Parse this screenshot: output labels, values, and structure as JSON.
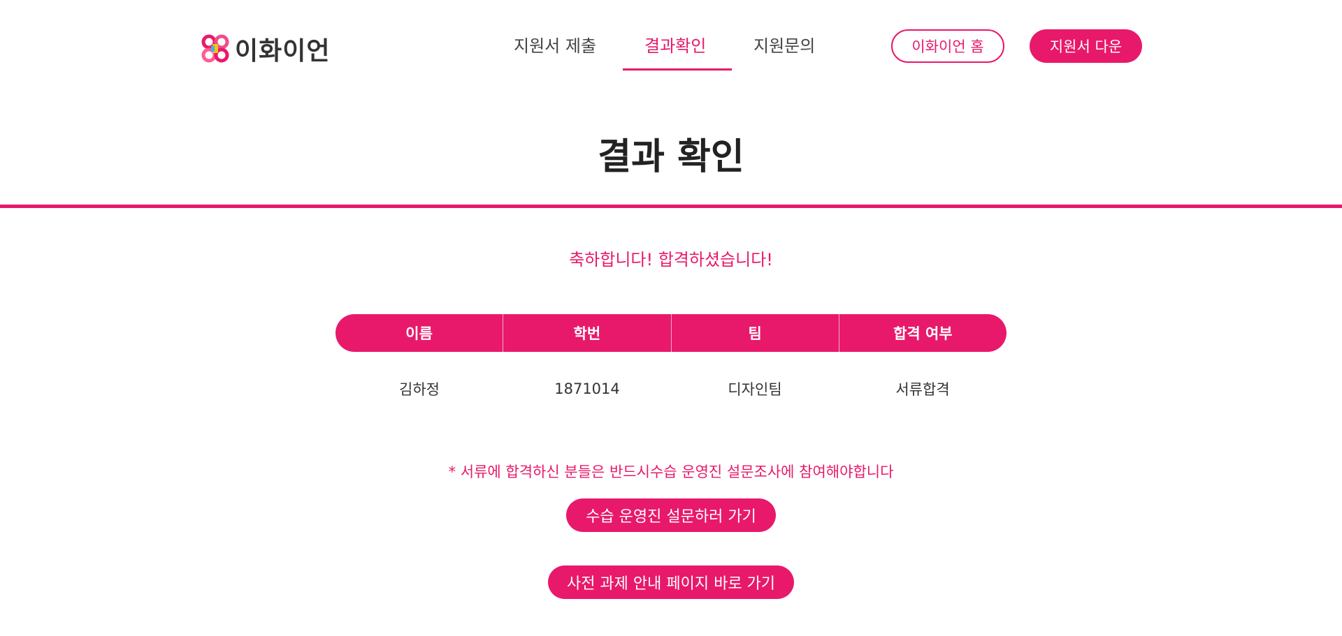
{
  "brand": {
    "name": "이화이언",
    "accent": "#e8196a"
  },
  "nav": {
    "items": [
      "지원서 제출",
      "결과확인",
      "지원문의"
    ],
    "active": "결과확인"
  },
  "header_buttons": {
    "home": "이화이언 홈",
    "download": "지원서 다운"
  },
  "page": {
    "title": "결과 확인",
    "congrats": "축하합니다! 합격하셨습니다!"
  },
  "table": {
    "headers": [
      "이름",
      "학번",
      "팀",
      "합격 여부"
    ],
    "row": [
      "김하정",
      "1871014",
      "디자인팀",
      "서류합격"
    ]
  },
  "notice": "* 서류에 합격하신 분들은 반드시수습 운영진 설문조사에 참여해야합니다",
  "buttons": {
    "survey": "수습 운영진 설문하러 가기",
    "task": "사전 과제 안내 페이지 바로 가기"
  },
  "icons": {
    "logo": "ewhaian-logo-icon"
  }
}
